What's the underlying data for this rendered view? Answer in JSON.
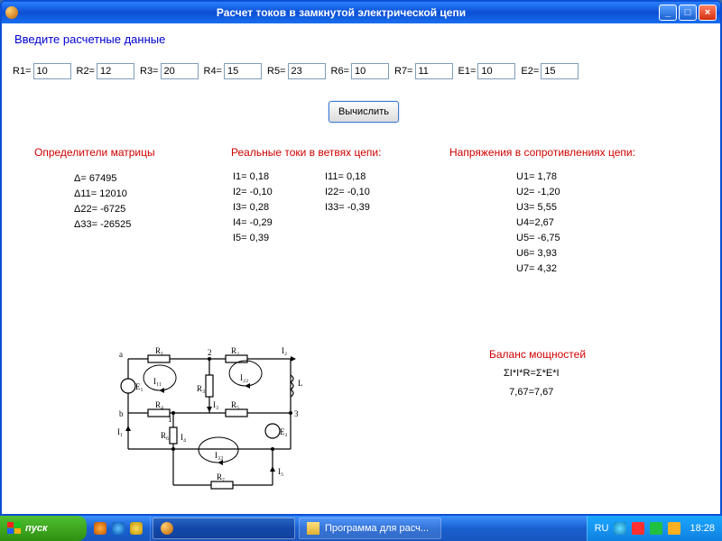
{
  "window": {
    "title": "Расчет токов в замкнутой электрической цепи"
  },
  "input_header": "Введите  расчетные данные",
  "fields": {
    "R1": {
      "label": "R1=",
      "value": "10"
    },
    "R2": {
      "label": "R2=",
      "value": "12"
    },
    "R3": {
      "label": "R3=",
      "value": "20"
    },
    "R4": {
      "label": "R4=",
      "value": "15"
    },
    "R5": {
      "label": "R5=",
      "value": "23"
    },
    "R6": {
      "label": "R6=",
      "value": "10"
    },
    "R7": {
      "label": "R7=",
      "value": "11"
    },
    "E1": {
      "label": "E1=",
      "value": "10"
    },
    "E2": {
      "label": "E2=",
      "value": "15"
    }
  },
  "compute_label": "Вычислить",
  "sections": {
    "det": "Определители матрицы",
    "currents": "Реальные токи в ветвях цепи:",
    "voltages": "Напряжения в сопротивлениях цепи:",
    "balance": "Баланс мощностей"
  },
  "det": {
    "d": "Δ= 67495",
    "d11": "Δ11= 12010",
    "d22": "Δ22= -6725",
    "d33": "Δ33= -26525"
  },
  "curA": {
    "i1": "I1= 0,18",
    "i2": "I2= -0,10",
    "i3": "I3= 0,28",
    "i4": "I4= -0,29",
    "i5": "I5= 0,39"
  },
  "curB": {
    "i11": "I11= 0,18",
    "i22": "I22= -0,10",
    "i33": "I33= -0,39"
  },
  "volt": {
    "u1": "U1= 1,78",
    "u2": "U2= -1,20",
    "u3": "U3= 5,55",
    "u4": "U4=2,67",
    "u5": "U5= -6,75",
    "u6": "U6= 3,93",
    "u7": "U7= 4,32"
  },
  "balance": {
    "formula": "ΣI*I*R=Σ*E*I",
    "value": "7,67=7,67"
  },
  "diagram": {
    "R1": "R₁",
    "R2": "R₂",
    "R3": "R₃",
    "R4": "R₄",
    "R5": "R₅",
    "R6": "R₆",
    "R7": "R₇",
    "E1": "E₁",
    "E2": "E₂",
    "I1": "I₁",
    "I2": "I₂",
    "I3": "I₃",
    "I4": "I₄",
    "I5": "I₅",
    "I11": "I₁₁",
    "I22": "I₂₂",
    "I33": "I₃₃",
    "L": "L",
    "n1": "1",
    "n2": "2",
    "n3": "3",
    "na": "a",
    "nb": "b"
  },
  "taskbar": {
    "start": "пуск",
    "app1": "",
    "app2": "Программа для расч...",
    "lang": "RU",
    "clock": "18:28"
  }
}
